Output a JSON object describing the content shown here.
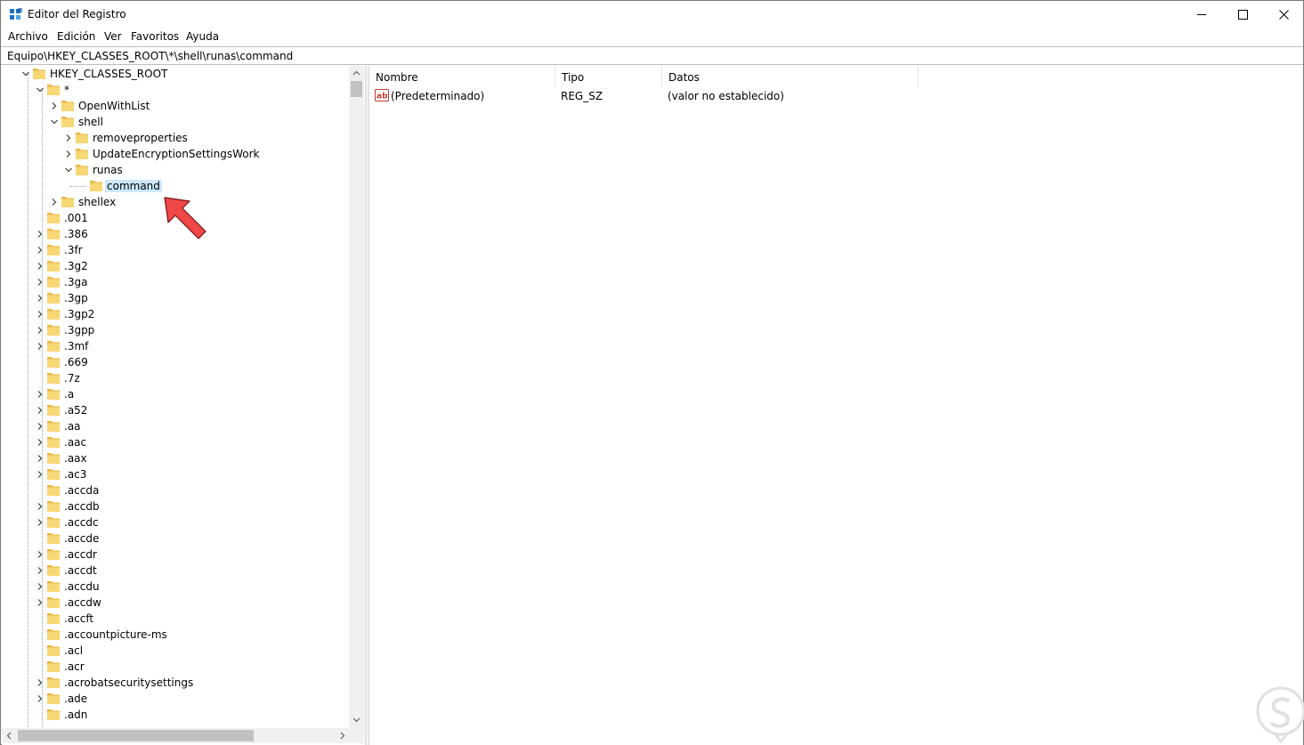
{
  "window": {
    "title": "Editor del Registro"
  },
  "menu": {
    "items": [
      "Archivo",
      "Edición",
      "Ver",
      "Favoritos",
      "Ayuda"
    ]
  },
  "address": {
    "path": "Equipo\\HKEY_CLASSES_ROOT\\*\\shell\\runas\\command"
  },
  "tree": {
    "nodes": [
      {
        "label": "HKEY_CLASSES_ROOT",
        "level": 0,
        "state": "expanded"
      },
      {
        "label": "*",
        "level": 1,
        "state": "expanded"
      },
      {
        "label": "OpenWithList",
        "level": 2,
        "state": "collapsed"
      },
      {
        "label": "shell",
        "level": 2,
        "state": "expanded"
      },
      {
        "label": "removeproperties",
        "level": 3,
        "state": "collapsed"
      },
      {
        "label": "UpdateEncryptionSettingsWork",
        "level": 3,
        "state": "collapsed"
      },
      {
        "label": "runas",
        "level": 3,
        "state": "expanded"
      },
      {
        "label": "command",
        "level": 4,
        "state": "leaf",
        "selected": true
      },
      {
        "label": "shellex",
        "level": 2,
        "state": "collapsed"
      },
      {
        "label": ".001",
        "level": 1,
        "state": "leaf"
      },
      {
        "label": ".386",
        "level": 1,
        "state": "collapsed"
      },
      {
        "label": ".3fr",
        "level": 1,
        "state": "collapsed"
      },
      {
        "label": ".3g2",
        "level": 1,
        "state": "collapsed"
      },
      {
        "label": ".3ga",
        "level": 1,
        "state": "collapsed"
      },
      {
        "label": ".3gp",
        "level": 1,
        "state": "collapsed"
      },
      {
        "label": ".3gp2",
        "level": 1,
        "state": "collapsed"
      },
      {
        "label": ".3gpp",
        "level": 1,
        "state": "collapsed"
      },
      {
        "label": ".3mf",
        "level": 1,
        "state": "collapsed"
      },
      {
        "label": ".669",
        "level": 1,
        "state": "leaf"
      },
      {
        "label": ".7z",
        "level": 1,
        "state": "leaf"
      },
      {
        "label": ".a",
        "level": 1,
        "state": "collapsed"
      },
      {
        "label": ".a52",
        "level": 1,
        "state": "collapsed"
      },
      {
        "label": ".aa",
        "level": 1,
        "state": "collapsed"
      },
      {
        "label": ".aac",
        "level": 1,
        "state": "collapsed"
      },
      {
        "label": ".aax",
        "level": 1,
        "state": "collapsed"
      },
      {
        "label": ".ac3",
        "level": 1,
        "state": "collapsed"
      },
      {
        "label": ".accda",
        "level": 1,
        "state": "leaf"
      },
      {
        "label": ".accdb",
        "level": 1,
        "state": "collapsed"
      },
      {
        "label": ".accdc",
        "level": 1,
        "state": "collapsed"
      },
      {
        "label": ".accde",
        "level": 1,
        "state": "leaf"
      },
      {
        "label": ".accdr",
        "level": 1,
        "state": "collapsed"
      },
      {
        "label": ".accdt",
        "level": 1,
        "state": "collapsed"
      },
      {
        "label": ".accdu",
        "level": 1,
        "state": "collapsed"
      },
      {
        "label": ".accdw",
        "level": 1,
        "state": "collapsed"
      },
      {
        "label": ".accft",
        "level": 1,
        "state": "leaf"
      },
      {
        "label": ".accountpicture-ms",
        "level": 1,
        "state": "leaf"
      },
      {
        "label": ".acl",
        "level": 1,
        "state": "leaf"
      },
      {
        "label": ".acr",
        "level": 1,
        "state": "leaf"
      },
      {
        "label": ".acrobatsecuritysettings",
        "level": 1,
        "state": "collapsed"
      },
      {
        "label": ".ade",
        "level": 1,
        "state": "collapsed"
      },
      {
        "label": ".adn",
        "level": 1,
        "state": "leaf"
      }
    ]
  },
  "values": {
    "columns": [
      "Nombre",
      "Tipo",
      "Datos"
    ],
    "rows": [
      {
        "name": "(Predeterminado)",
        "type": "REG_SZ",
        "data": "(valor no establecido)"
      }
    ]
  },
  "colors": {
    "selection": "#cce8ff",
    "folder": "#f8d775",
    "annotation_arrow": "#f04848"
  }
}
